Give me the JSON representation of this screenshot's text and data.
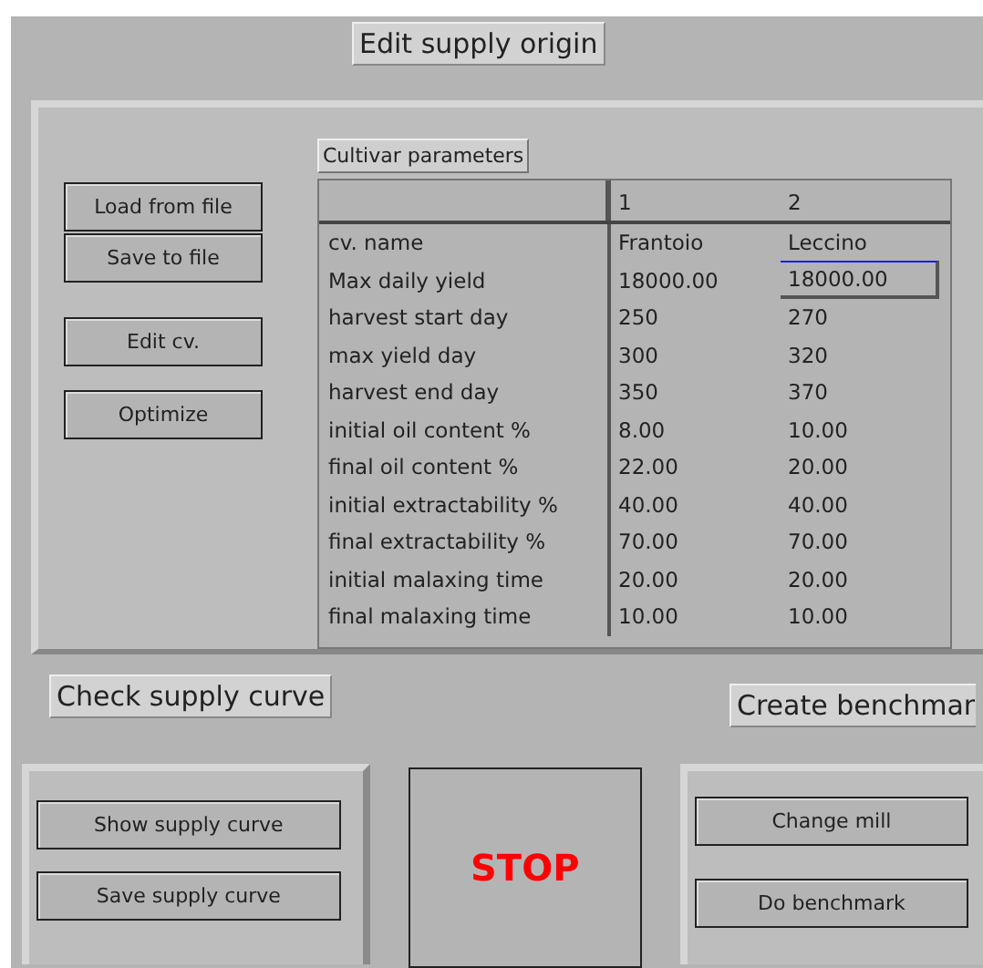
{
  "title": "Edit supply origin",
  "cultivar_parameters": {
    "label": "Cultivar parameters",
    "buttons": [
      {
        "label": "Load from file"
      },
      {
        "label": "Save to file"
      },
      {
        "label": "Edit cv."
      },
      {
        "label": "Optimize"
      }
    ],
    "columns": [
      "1",
      "2"
    ],
    "rows": [
      {
        "label": "cv. name",
        "cells": [
          {
            "text": "Frantoio",
            "focused": false
          },
          {
            "text": "Leccino",
            "focused": false
          }
        ]
      },
      {
        "label": "Max daily yield",
        "cells": [
          {
            "text": "18000.00",
            "focused": false
          },
          {
            "text": "18000.00",
            "focused": true
          }
        ]
      },
      {
        "label": "harvest start day",
        "cells": [
          {
            "text": "250",
            "focused": false
          },
          {
            "text": "270",
            "focused": false
          }
        ]
      },
      {
        "label": "max yield day",
        "cells": [
          {
            "text": "300",
            "focused": false
          },
          {
            "text": "320",
            "focused": false
          }
        ]
      },
      {
        "label": "harvest end day",
        "cells": [
          {
            "text": "350",
            "focused": false
          },
          {
            "text": "370",
            "focused": false
          }
        ]
      },
      {
        "label": "initial oil content %",
        "cells": [
          {
            "text": "8.00",
            "focused": false
          },
          {
            "text": "10.00",
            "focused": false
          }
        ]
      },
      {
        "label": "final oil content %",
        "cells": [
          {
            "text": "22.00",
            "focused": false
          },
          {
            "text": "20.00",
            "focused": false
          }
        ]
      },
      {
        "label": "initial extractability %",
        "cells": [
          {
            "text": "40.00",
            "focused": false
          },
          {
            "text": "40.00",
            "focused": false
          }
        ]
      },
      {
        "label": "final extractability %",
        "cells": [
          {
            "text": "70.00",
            "focused": false
          },
          {
            "text": "70.00",
            "focused": false
          }
        ]
      },
      {
        "label": "initial malaxing time",
        "cells": [
          {
            "text": "20.00",
            "focused": false
          },
          {
            "text": "20.00",
            "focused": false
          }
        ]
      },
      {
        "label": "final malaxing time",
        "cells": [
          {
            "text": "10.00",
            "focused": false
          },
          {
            "text": "10.00",
            "focused": false
          }
        ]
      }
    ]
  },
  "check_supply_curve": {
    "label": "Check supply curve",
    "buttons": [
      "Show supply curve",
      "Save supply curve"
    ]
  },
  "stop_button": "STOP",
  "create_benchmark": {
    "label": "Create benchmar",
    "buttons": [
      "Change mill",
      "Do benchmark"
    ]
  }
}
